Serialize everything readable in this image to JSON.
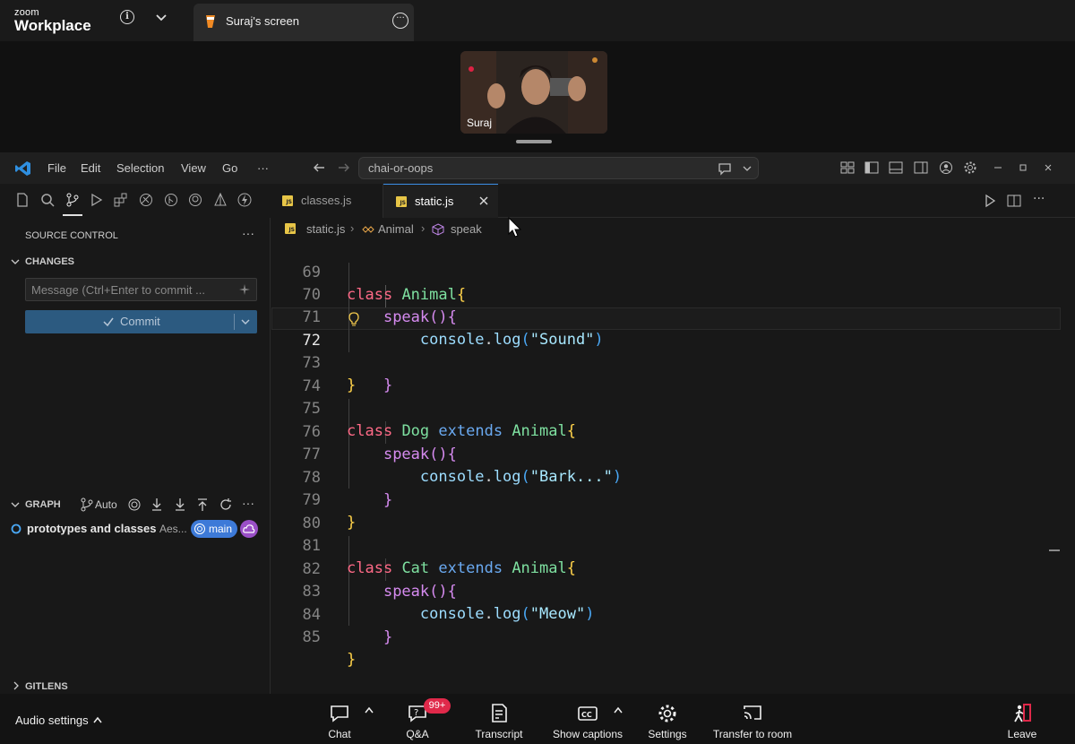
{
  "zoom": {
    "logo_small": "zoom",
    "logo_big": "Workplace",
    "share_tab_label": "Suraj's screen",
    "participant_name": "Suraj",
    "audio_settings": "Audio settings",
    "toolbar": {
      "chat": "Chat",
      "qa": "Q&A",
      "qa_badge": "99+",
      "transcript": "Transcript",
      "captions": "Show captions",
      "settings": "Settings",
      "transfer": "Transfer to room",
      "leave": "Leave"
    }
  },
  "vscode": {
    "menu": [
      "File",
      "Edit",
      "Selection",
      "View",
      "Go",
      "···"
    ],
    "command_center": "chai-or-oops",
    "sidebar": {
      "title": "SOURCE CONTROL",
      "more": "···",
      "changes_label": "CHANGES",
      "message_placeholder": "Message (Ctrl+Enter to commit ...",
      "commit_label": "Commit",
      "graph_label": "GRAPH",
      "graph_auto": "Auto",
      "commit_title": "prototypes and classes",
      "commit_author": "Aes...",
      "branch": "main",
      "gitlens_label": "GITLENS"
    },
    "tabs": [
      {
        "label": "classes.js",
        "active": false
      },
      {
        "label": "static.js",
        "active": true
      }
    ],
    "breadcrumbs": [
      "static.js",
      "Animal",
      "speak"
    ],
    "active_line": 72,
    "code": [
      {
        "n": 69,
        "text": "class Animal{"
      },
      {
        "n": 70,
        "text": "    speak(){"
      },
      {
        "n": 71,
        "text": "        console.log(\"Sound\")"
      },
      {
        "n": 72,
        "text": "    }"
      },
      {
        "n": 73,
        "text": "}"
      },
      {
        "n": 74,
        "text": ""
      },
      {
        "n": 75,
        "text": "class Dog extends Animal{"
      },
      {
        "n": 76,
        "text": "    speak(){"
      },
      {
        "n": 77,
        "text": "        console.log(\"Bark...\")"
      },
      {
        "n": 78,
        "text": "    }"
      },
      {
        "n": 79,
        "text": "}"
      },
      {
        "n": 80,
        "text": ""
      },
      {
        "n": 81,
        "text": "class Cat extends Animal{"
      },
      {
        "n": 82,
        "text": "    speak(){"
      },
      {
        "n": 83,
        "text": "        console.log(\"Meow\")"
      },
      {
        "n": 84,
        "text": "    }"
      },
      {
        "n": 85,
        "text": "}"
      }
    ]
  },
  "colors": {
    "accent_blue": "#3d7ad8",
    "commit_button": "#2c5a80",
    "qa_badge": "#e0294a",
    "leave_icon": "#e0294a"
  }
}
